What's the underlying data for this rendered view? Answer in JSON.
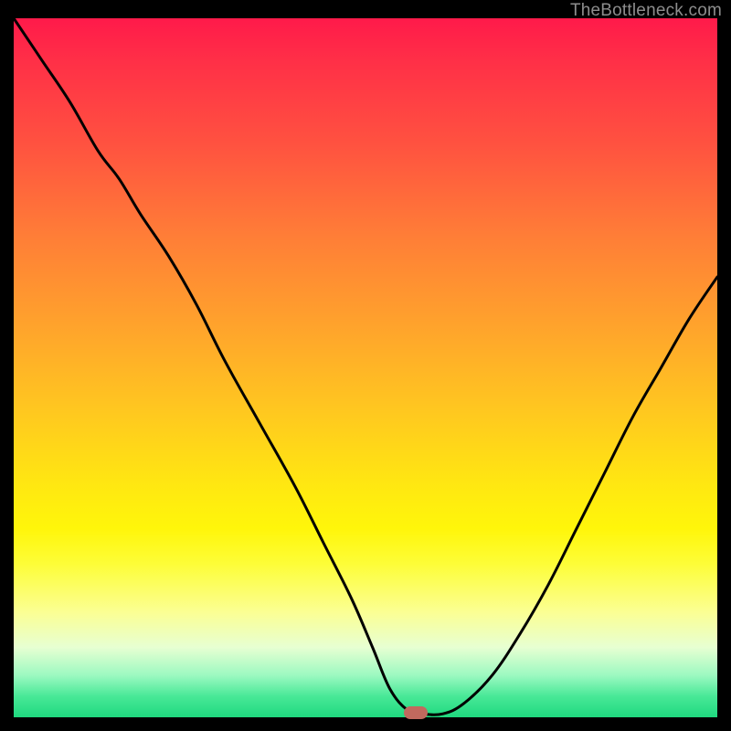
{
  "watermark": "TheBottleneck.com",
  "colors": {
    "frame": "#000000",
    "curve": "#000000",
    "marker": "#c1695e"
  },
  "chart_data": {
    "type": "line",
    "title": "",
    "xlabel": "",
    "ylabel": "",
    "xlim": [
      0,
      100
    ],
    "ylim": [
      0,
      100
    ],
    "grid": false,
    "legend": false,
    "annotations": [
      "TheBottleneck.com"
    ],
    "series": [
      {
        "name": "bottleneck-curve",
        "x": [
          0,
          4,
          8,
          12,
          15,
          18,
          22,
          26,
          30,
          35,
          40,
          44,
          48,
          51,
          53.5,
          56,
          58,
          61,
          64,
          68,
          72,
          76,
          80,
          84,
          88,
          92,
          96,
          100
        ],
        "y": [
          100,
          94,
          88,
          81,
          77,
          72,
          66,
          59,
          51,
          42,
          33,
          25,
          17,
          10,
          4,
          1,
          0.5,
          0.5,
          2,
          6,
          12,
          19,
          27,
          35,
          43,
          50,
          57,
          63
        ]
      }
    ],
    "marker": {
      "x": 57.2,
      "y": 0.6
    }
  }
}
